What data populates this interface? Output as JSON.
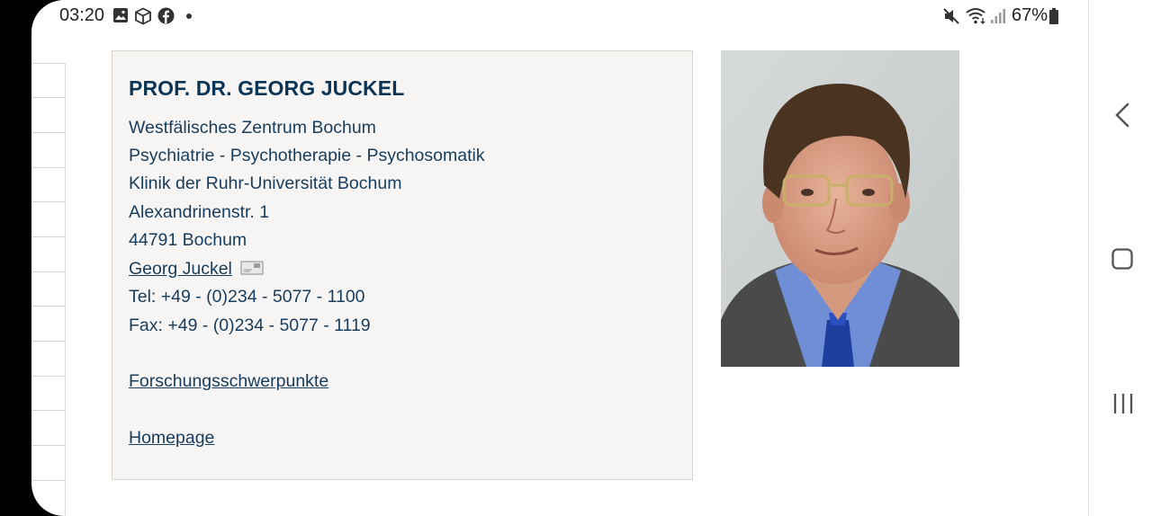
{
  "status_bar": {
    "time": "03:20",
    "battery": "67%",
    "icons": [
      "image-icon",
      "cube-icon",
      "facebook-icon",
      "dot-icon",
      "mute-icon",
      "wifi-icon",
      "signal-icon",
      "battery-icon"
    ]
  },
  "contact": {
    "name": "PROF. DR. GEORG JUCKEL",
    "lines": [
      "Westfälisches Zentrum Bochum",
      "Psychiatrie - Psychotherapie - Psychosomatik",
      "Klinik der Ruhr-Universität Bochum",
      "Alexandrinenstr. 1",
      "44791 Bochum"
    ],
    "email_link": "Georg Juckel",
    "tel": "Tel: +49 - (0)234 - 5077 - 1100",
    "fax": "Fax: +49 - (0)234 - 5077 - 1119",
    "research_link": "Forschungsschwerpunkte",
    "homepage_link": "Homepage"
  },
  "nav_bar": {
    "icons": [
      "back-icon",
      "home-icon",
      "recents-icon"
    ]
  }
}
